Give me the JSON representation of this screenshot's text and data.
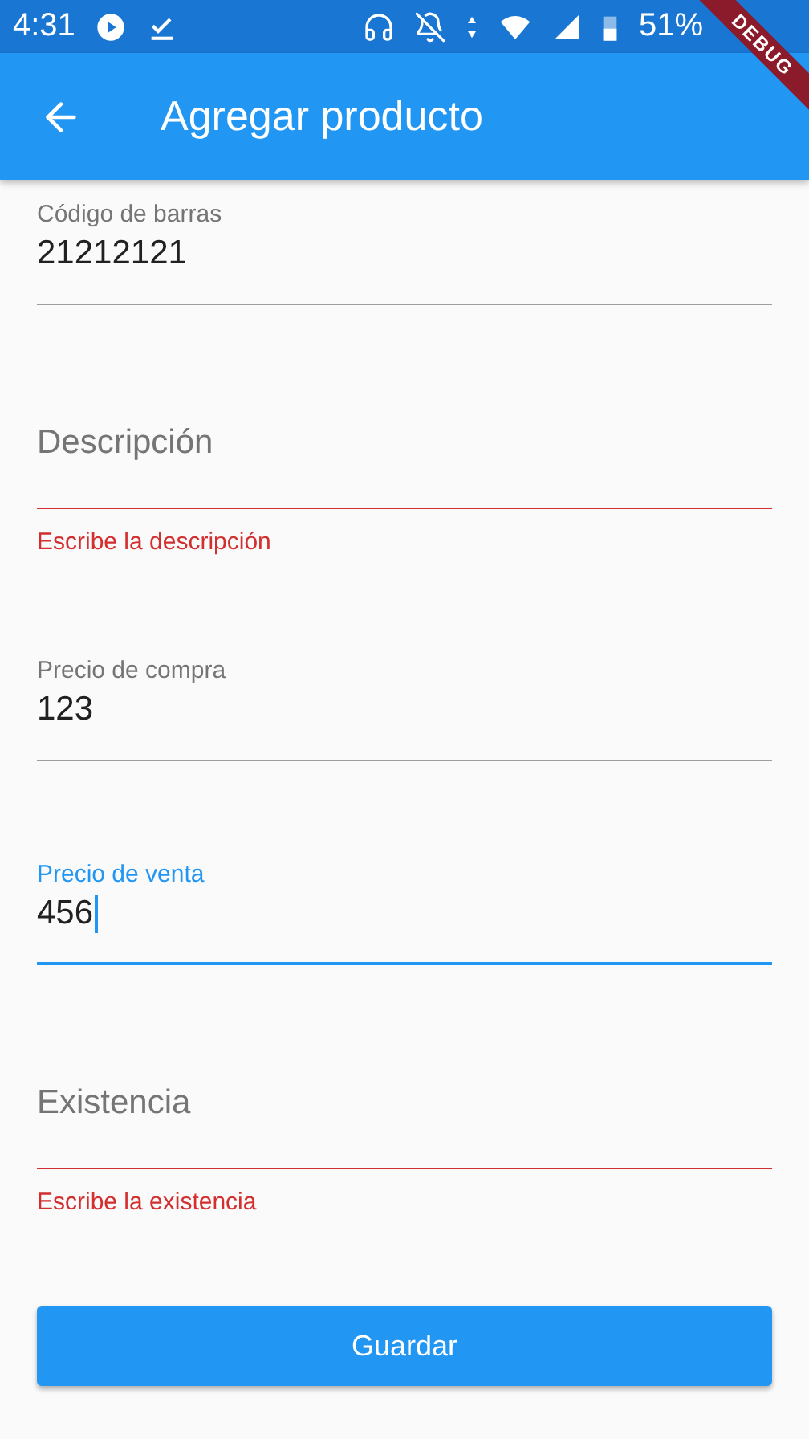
{
  "status_bar": {
    "time": "4:31",
    "battery": "51%"
  },
  "debug_banner": "DEBUG",
  "app_bar": {
    "title": "Agregar producto"
  },
  "fields": [
    {
      "kind": "filled",
      "label": "Código de barras",
      "value": "21212121",
      "focused": false
    },
    {
      "kind": "empty",
      "placeholder": "Descripción",
      "error": "Escribe la descripción"
    },
    {
      "kind": "filled",
      "label": "Precio de compra",
      "value": "123",
      "focused": false
    },
    {
      "kind": "filled",
      "label": "Precio de venta",
      "value": "456",
      "focused": true
    },
    {
      "kind": "empty",
      "placeholder": "Existencia",
      "error": "Escribe la existencia"
    }
  ],
  "button": "Guardar"
}
